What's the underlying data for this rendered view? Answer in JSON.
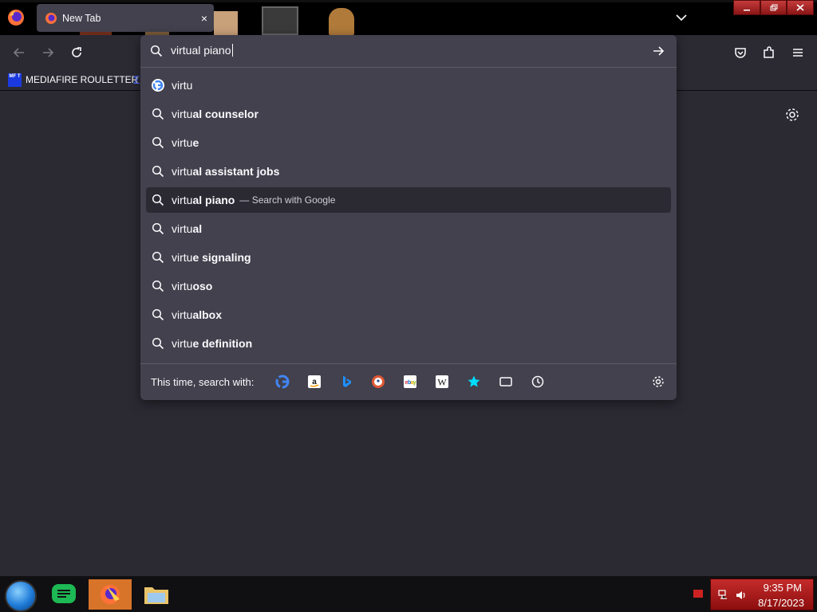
{
  "window": {
    "controls": [
      "minimize",
      "restore",
      "close"
    ]
  },
  "tab": {
    "title": "New Tab",
    "close_label": "×"
  },
  "bookmarks": {
    "items": [
      {
        "label": "MEDIAFIRE ROULETTER",
        "icon_text": "MF T"
      }
    ]
  },
  "urlbar": {
    "value": "virtual piano",
    "results": [
      {
        "typed": "virtu",
        "completion": "",
        "icon": "google-icon",
        "hint": ""
      },
      {
        "typed": "virtu",
        "completion": "al counselor",
        "icon": "search-icon",
        "hint": ""
      },
      {
        "typed": "virtu",
        "completion": "e",
        "icon": "search-icon",
        "hint": ""
      },
      {
        "typed": "virtu",
        "completion": "al assistant jobs",
        "icon": "search-icon",
        "hint": ""
      },
      {
        "typed": "virtu",
        "completion": "al piano",
        "icon": "search-icon",
        "hint": "Search with Google",
        "selected": true
      },
      {
        "typed": "virtu",
        "completion": "al",
        "icon": "search-icon",
        "hint": ""
      },
      {
        "typed": "virtu",
        "completion": "e signaling",
        "icon": "search-icon",
        "hint": ""
      },
      {
        "typed": "virtu",
        "completion": "oso",
        "icon": "search-icon",
        "hint": ""
      },
      {
        "typed": "virtu",
        "completion": "albox",
        "icon": "search-icon",
        "hint": ""
      },
      {
        "typed": "virtu",
        "completion": "e definition",
        "icon": "search-icon",
        "hint": ""
      }
    ],
    "oneoff_label": "This time, search with:",
    "engines": [
      {
        "name": "google-icon"
      },
      {
        "name": "amazon-icon"
      },
      {
        "name": "bing-icon"
      },
      {
        "name": "duckduckgo-icon"
      },
      {
        "name": "ebay-icon"
      },
      {
        "name": "wikipedia-icon"
      },
      {
        "name": "bookmarks-star-icon"
      },
      {
        "name": "tabs-icon"
      },
      {
        "name": "history-icon"
      }
    ]
  },
  "taskbar": {
    "time": "9:35 PM",
    "date": "8/17/2023"
  },
  "colors": {
    "panel": "#42414d",
    "toolbar": "#2b2a33",
    "text": "#fbfbfe",
    "tray": "#c52b2b"
  }
}
